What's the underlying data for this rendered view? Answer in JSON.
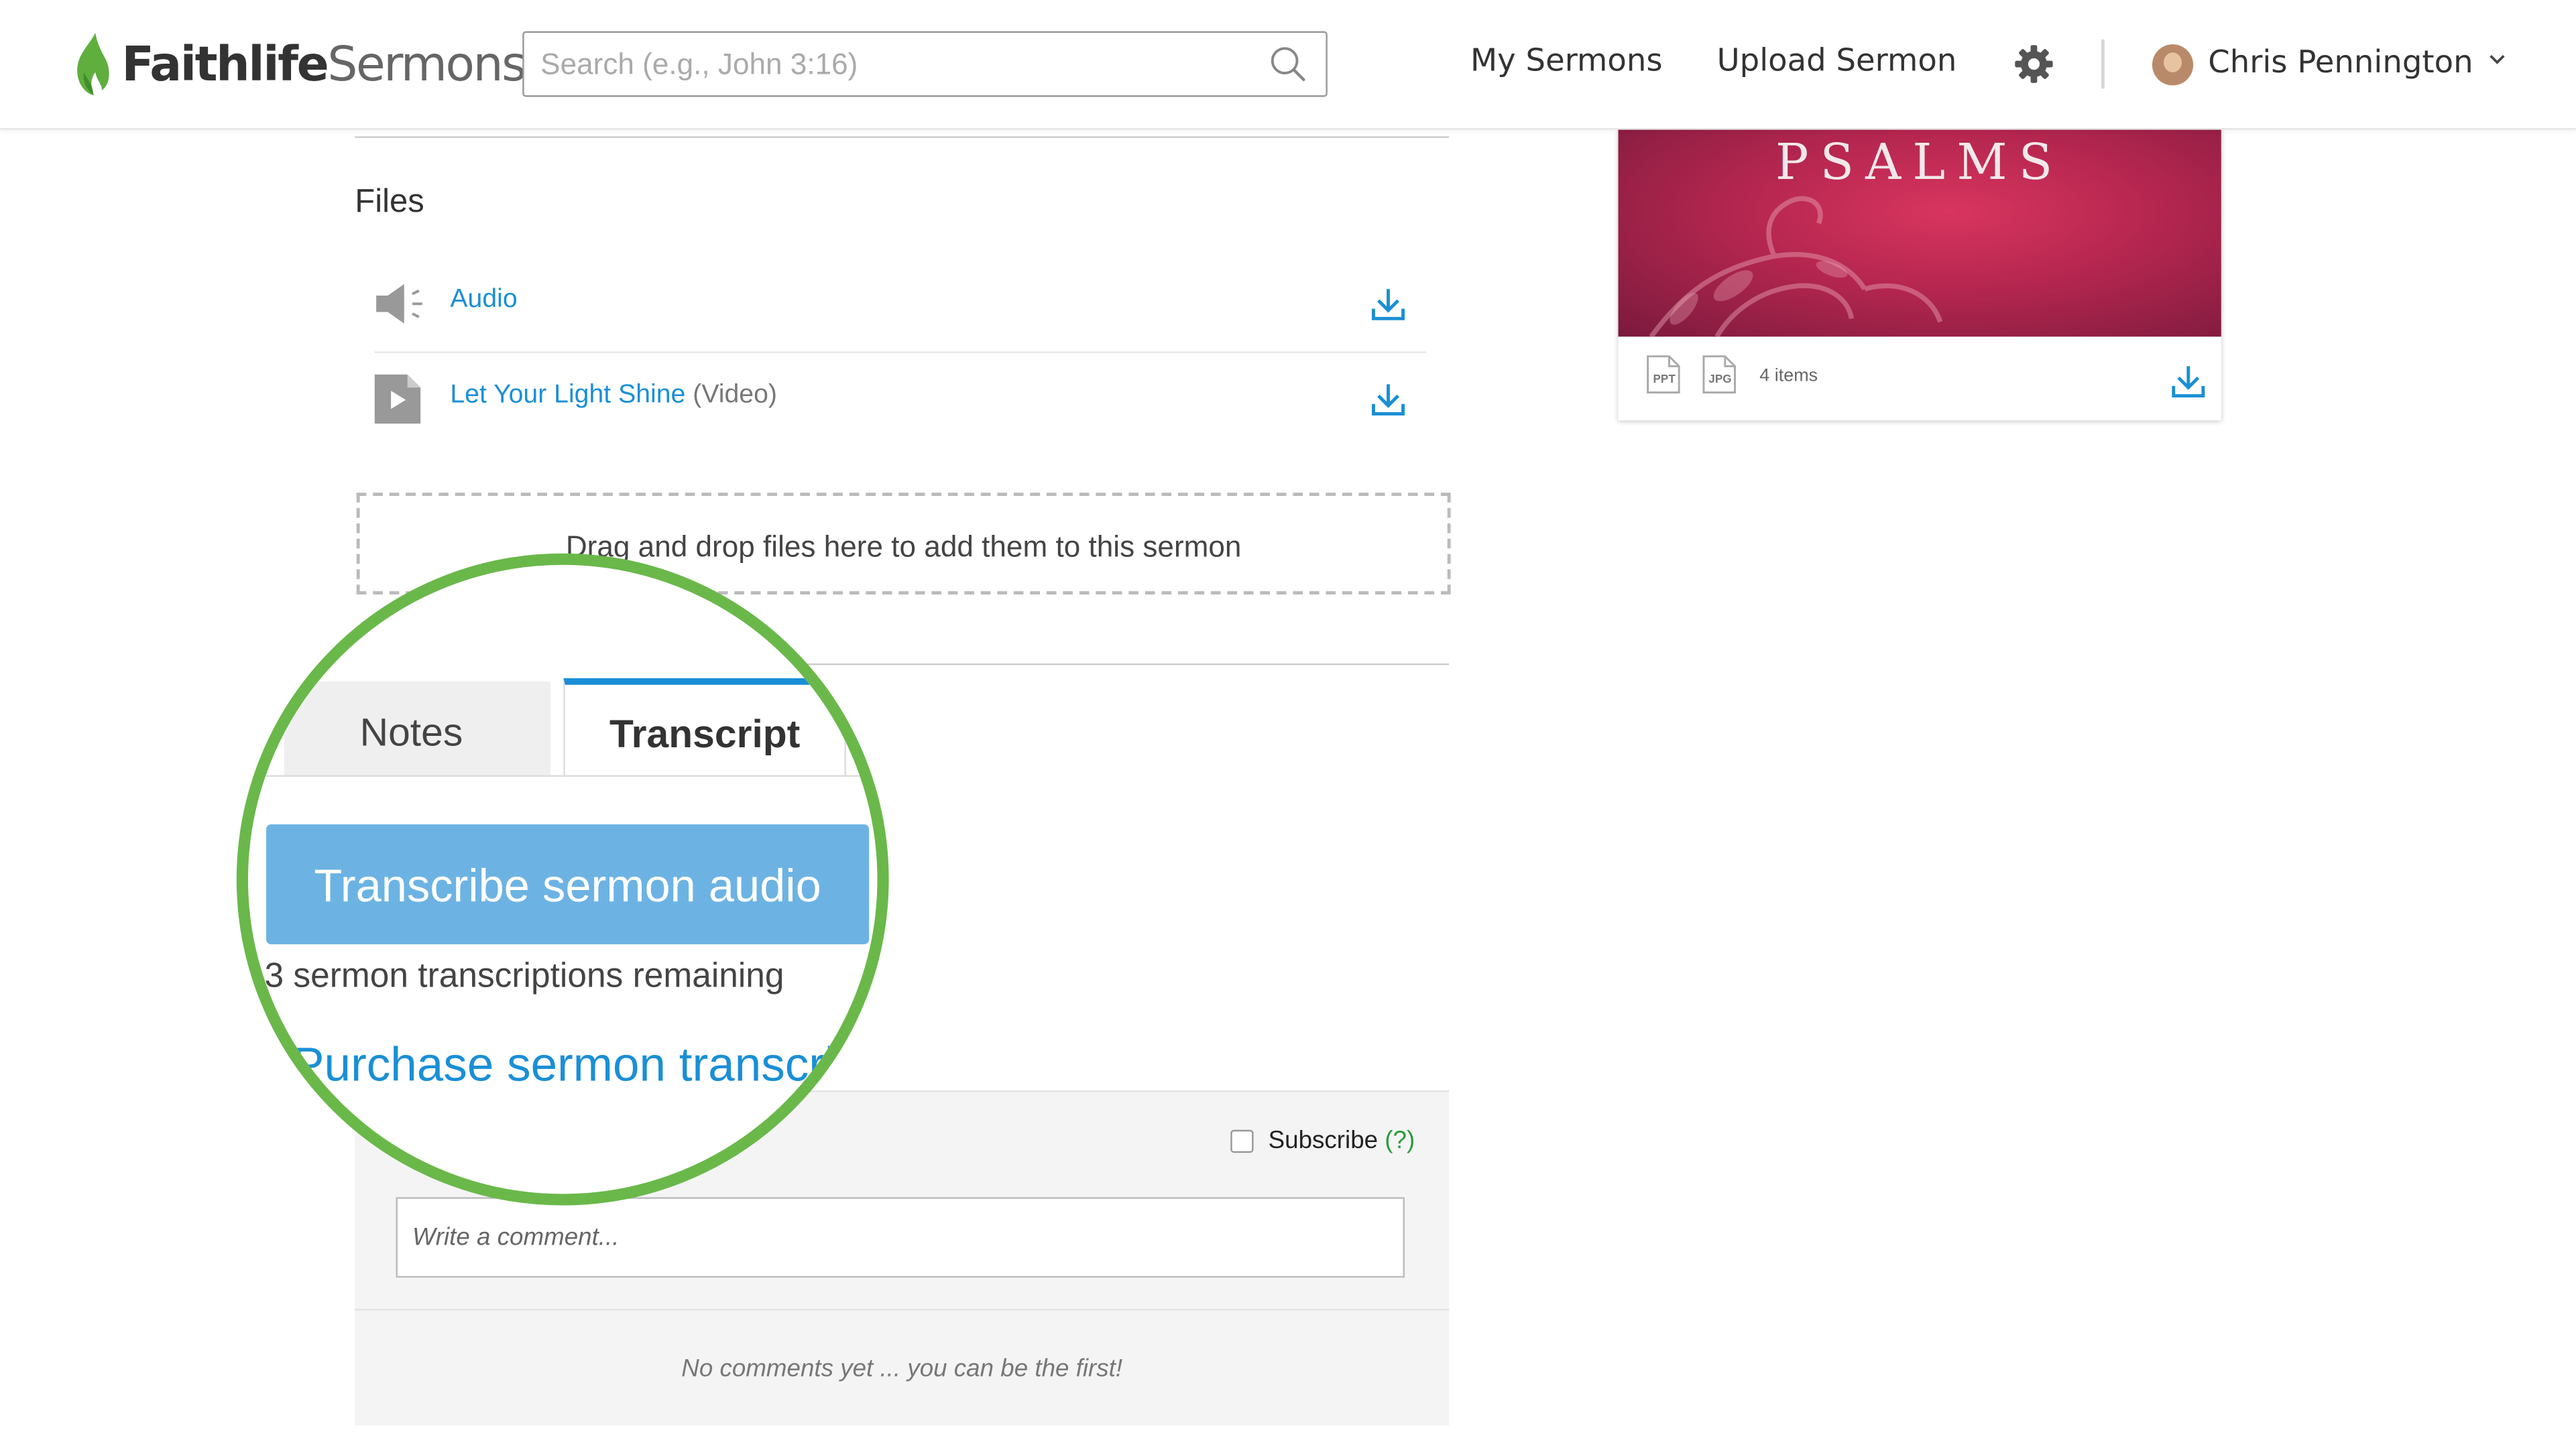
{
  "header": {
    "logo_bold": "Faithlife",
    "logo_light": "Sermons",
    "search_placeholder": "Search (e.g., John 3:16)",
    "nav": [
      "My Sermons",
      "Upload Sermon"
    ],
    "user_name": "Chris Pennington"
  },
  "files": {
    "title": "Files",
    "items": [
      {
        "label": "Audio",
        "kind": "",
        "icon": "speaker-icon"
      },
      {
        "label": "Let Your Light Shine",
        "kind": "(Video)",
        "icon": "video-file-icon"
      }
    ],
    "dropzone_text": "Drag and drop files here to add them to this sermon"
  },
  "tabs": {
    "notes": "Notes",
    "transcript": "Transcript",
    "active": "Transcript"
  },
  "transcript": {
    "button": "Transcribe sermon audio",
    "remaining": "3 sermon transcriptions remaining",
    "purchase_link": "Purchase sermon transcripts"
  },
  "comments": {
    "subscribe_label": "Subscribe",
    "help": "(?)",
    "input_placeholder": "Write a comment...",
    "empty_text": "No comments yet ... you can be the first!"
  },
  "series_card": {
    "image_title": "PSALMS",
    "file_types": [
      "PPT",
      "JPG"
    ],
    "items": "4 items"
  },
  "colors": {
    "brand_green": "#6ab84a",
    "link_blue": "#1a8fd6",
    "button_blue": "#6cb3e3"
  }
}
